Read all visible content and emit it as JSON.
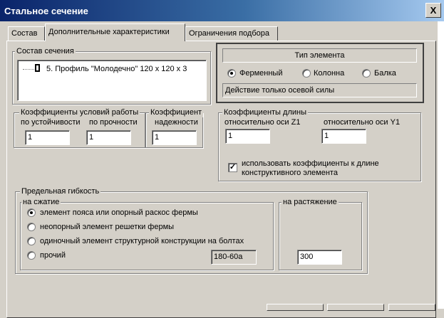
{
  "window": {
    "title": "Стальное сечение",
    "close": "X"
  },
  "tabs": [
    {
      "label": "Состав"
    },
    {
      "label": "Дополнительные характеристики"
    },
    {
      "label": "Ограничения подбора"
    }
  ],
  "composition": {
    "legend": "Состав сечения",
    "items": [
      {
        "icon": "I",
        "label": "5. Профиль \"Молодечно\" 120 x 120 x 3"
      }
    ]
  },
  "element_type": {
    "header": "Тип элемента",
    "options": [
      "Ферменный",
      "Колонна",
      "Балка"
    ],
    "selected": "Ферменный",
    "status": "Действие только осевой силы"
  },
  "work_conditions": {
    "legend": "Коэффициенты условий работы",
    "stability_label": "по устойчивости",
    "stability_value": "1",
    "strength_label": "по прочности",
    "strength_value": "1"
  },
  "reliability": {
    "legend_line1": "Коэффициент",
    "legend_line2": "надежности",
    "value": "1"
  },
  "length_coefficients": {
    "legend": "Коэффициенты длины",
    "z1_label": "относительно оси Z1",
    "z1_value": "1",
    "y1_label": "относительно оси Y1",
    "y1_value": "1",
    "checkbox_label_line1": "использовать коэффициенты к длине",
    "checkbox_label_line2": "конструктивного элемента",
    "checkbox_checked": true,
    "check_mark": "✓"
  },
  "slenderness": {
    "legend": "Предельная гибкость",
    "compression": {
      "legend": "на сжатие",
      "options": [
        "элемент пояса или опорный раскос фермы",
        "неопорный элемент решетки фермы",
        "одиночный элемент структурной конструкции на болтах",
        "прочий"
      ],
      "selected_index": 0,
      "other_value": "180-60a"
    },
    "tension": {
      "legend": "на растяжение",
      "value": "300"
    }
  }
}
